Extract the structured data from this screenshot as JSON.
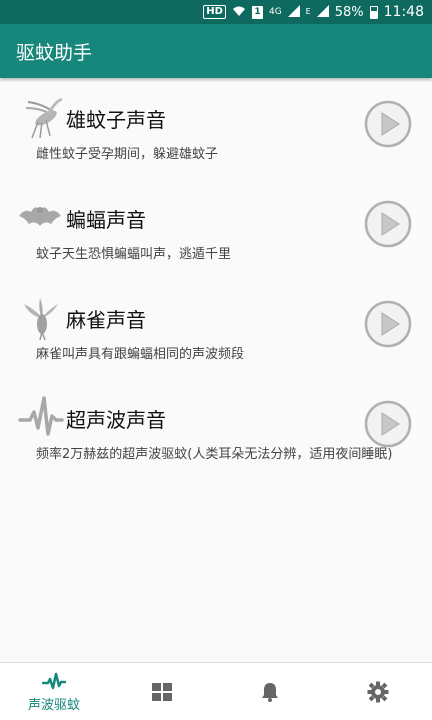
{
  "status_bar": {
    "hd": "HD",
    "sim": "1",
    "network": "4G",
    "signal2": "E",
    "battery": "58%",
    "time": "11:48"
  },
  "app_bar": {
    "title": "驱蚊助手"
  },
  "items": [
    {
      "title": "雄蚊子声音",
      "desc": "雌性蚊子受孕期间，躲避雄蚊子",
      "icon": "mosquito-icon"
    },
    {
      "title": "蝙蝠声音",
      "desc": "蚊子天生恐惧蝙蝠叫声，逃遁千里",
      "icon": "bat-icon"
    },
    {
      "title": "麻雀声音",
      "desc": "麻雀叫声具有跟蝙蝠相同的声波频段",
      "icon": "sparrow-icon"
    },
    {
      "title": "超声波声音",
      "desc": "频率2万赫兹的超声波驱蚊(人类耳朵无法分辨，适用夜间睡眠)",
      "icon": "ultrasonic-wave-icon"
    }
  ],
  "bottom_nav": {
    "items": [
      {
        "label": "声波驱蚊",
        "icon": "pulse-wave-icon",
        "active": true
      },
      {
        "label": "",
        "icon": "grid-icon",
        "active": false
      },
      {
        "label": "",
        "icon": "bell-icon",
        "active": false
      },
      {
        "label": "",
        "icon": "gear-icon",
        "active": false
      }
    ]
  },
  "colors": {
    "status_bar": "#0e6a5f",
    "app_bar": "#16877a",
    "accent": "#16877a",
    "background": "#fafafa",
    "icon_gray": "#a8a8a8"
  }
}
